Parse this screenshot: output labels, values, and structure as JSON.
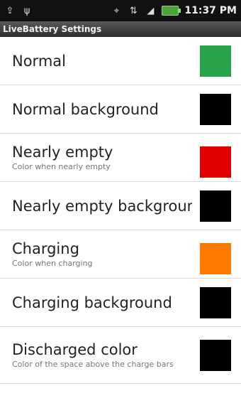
{
  "statusbar": {
    "left_icons": [
      "upload-icon",
      "usb-icon"
    ],
    "right_icons": [
      "gps-icon",
      "network-icon",
      "signal-icon"
    ],
    "time": "11:37 PM"
  },
  "title": "LiveBattery Settings",
  "items": [
    {
      "title": "Normal",
      "summary": "",
      "color": "#2aa44a"
    },
    {
      "title": "Normal background",
      "summary": "",
      "color": "#000000"
    },
    {
      "title": "Nearly empty",
      "summary": "Color when nearly empty",
      "color": "#e00000"
    },
    {
      "title": "Nearly empty background",
      "summary": "",
      "color": "#000000"
    },
    {
      "title": "Charging",
      "summary": "Color when charging",
      "color": "#ff7a00"
    },
    {
      "title": "Charging background",
      "summary": "",
      "color": "#000000"
    },
    {
      "title": "Discharged color",
      "summary": "Color of the space above the charge bars",
      "color": "#000000"
    }
  ]
}
